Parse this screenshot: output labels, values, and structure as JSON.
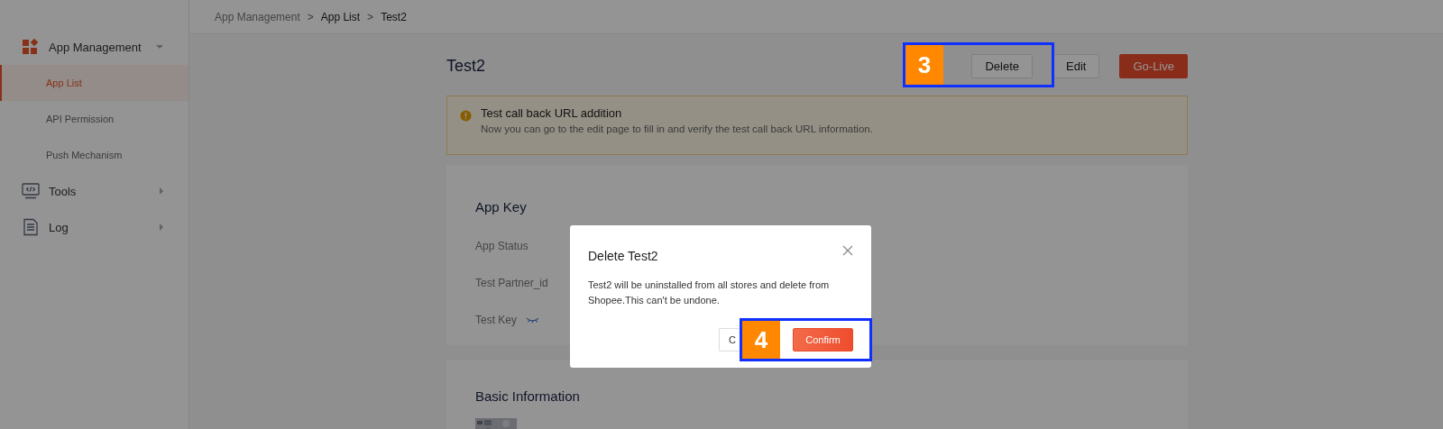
{
  "breadcrumb": [
    {
      "label": "App Management",
      "current": false
    },
    {
      "separator": ">",
      "label": "App List",
      "current": true
    },
    {
      "separator": ">",
      "label": "Test2",
      "current": true
    }
  ],
  "sidebar": {
    "items": [
      {
        "label": "App Management",
        "expanded": true,
        "children": [
          {
            "label": "App List",
            "selected": true
          },
          {
            "label": "API Permission",
            "selected": false
          },
          {
            "label": "Push Mechanism",
            "selected": false
          }
        ]
      },
      {
        "label": "Tools",
        "expanded": false
      },
      {
        "label": "Log",
        "expanded": false
      }
    ]
  },
  "page": {
    "title": "Test2",
    "buttons": [
      {
        "label": "Delete",
        "kind": "default"
      },
      {
        "label": "Edit",
        "kind": "default"
      },
      {
        "label": "Go-Live",
        "kind": "primary"
      }
    ]
  },
  "alert": {
    "title": "Test call back URL addition",
    "message": "Now you can go to the edit page to fill in and verify the test call back URL information."
  },
  "app_key": {
    "title": "App Key",
    "fields": [
      {
        "label": "App Status",
        "hidden_toggle": false
      },
      {
        "label": "Test Partner_id",
        "hidden_toggle": false
      },
      {
        "label": "Test Key",
        "hidden_toggle": true
      }
    ]
  },
  "basic_information": {
    "title": "Basic Information"
  },
  "dialog": {
    "title": "Delete Test2",
    "message": "Test2 will be uninstalled from all stores and delete from Shopee.This can't be undone.",
    "buttons": [
      {
        "label": "C",
        "kind": "default"
      },
      {
        "label": "Confirm",
        "kind": "primary"
      }
    ]
  },
  "annotations": [
    {
      "number": "3"
    },
    {
      "number": "4"
    }
  ]
}
